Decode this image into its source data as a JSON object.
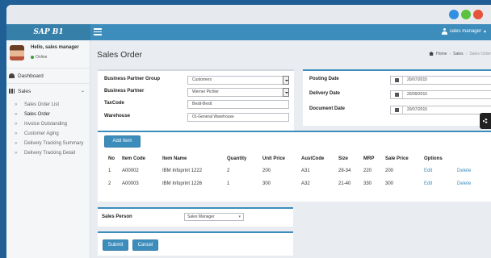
{
  "brand": "SAP B1",
  "user_menu": "sales manager",
  "user_panel": {
    "greeting": "Hello, sales manager",
    "status": "Online"
  },
  "sidebar": {
    "dashboard": "Dashboard",
    "sales": "Sales",
    "items": [
      "Sales Order List",
      "Sales Order",
      "Invoice Outstanding",
      "Customer Aging",
      "Delivery Tracking Summary",
      "Delivery Tracking Detail"
    ]
  },
  "page_title": "Sales Order",
  "breadcrumb": {
    "home": "Home",
    "section": "Sales",
    "current": "Sales Order"
  },
  "partner_form": {
    "bp_group_label": "Business Partner Group",
    "bp_group_value": "Customers",
    "bp_label": "Business Partner",
    "bp_value": "Werner Pichler",
    "taxcode_label": "TaxCode",
    "taxcode_value": "Bestt-Bestt",
    "warehouse_label": "Warehouse",
    "warehouse_value": "01-General Warehouse"
  },
  "dates": {
    "posting_label": "Posting Date",
    "posting_value": "20/07/2015",
    "delivery_label": "Delivery Date",
    "delivery_value": "20/09/2015",
    "document_label": "Document Date",
    "document_value": "20/07/2015"
  },
  "items_table": {
    "add_label": "Add Item",
    "columns": [
      "No",
      "Item Code",
      "Item Name",
      "Quantity",
      "Unit Price",
      "AustCode",
      "Size",
      "MRP",
      "Sale Price",
      "Options",
      ""
    ],
    "rows": [
      [
        "1",
        "A00002",
        "IBM Infoprint 1222",
        "2",
        "200",
        "A31",
        "28-34",
        "220",
        "200",
        "Edit",
        "Delete"
      ],
      [
        "2",
        "A00003",
        "IBM Infoprint 1226",
        "1",
        "300",
        "A32",
        "21-40",
        "330",
        "300",
        "Edit",
        "Delete"
      ]
    ]
  },
  "sales_person": {
    "label": "Sales Person",
    "value": "Sales Manager"
  },
  "actions": {
    "submit": "Submit",
    "cancel": "Cancel"
  },
  "colors": {
    "header": "#3c8dbc",
    "logo_bg": "#367fa9",
    "background": "#1f5f95"
  }
}
